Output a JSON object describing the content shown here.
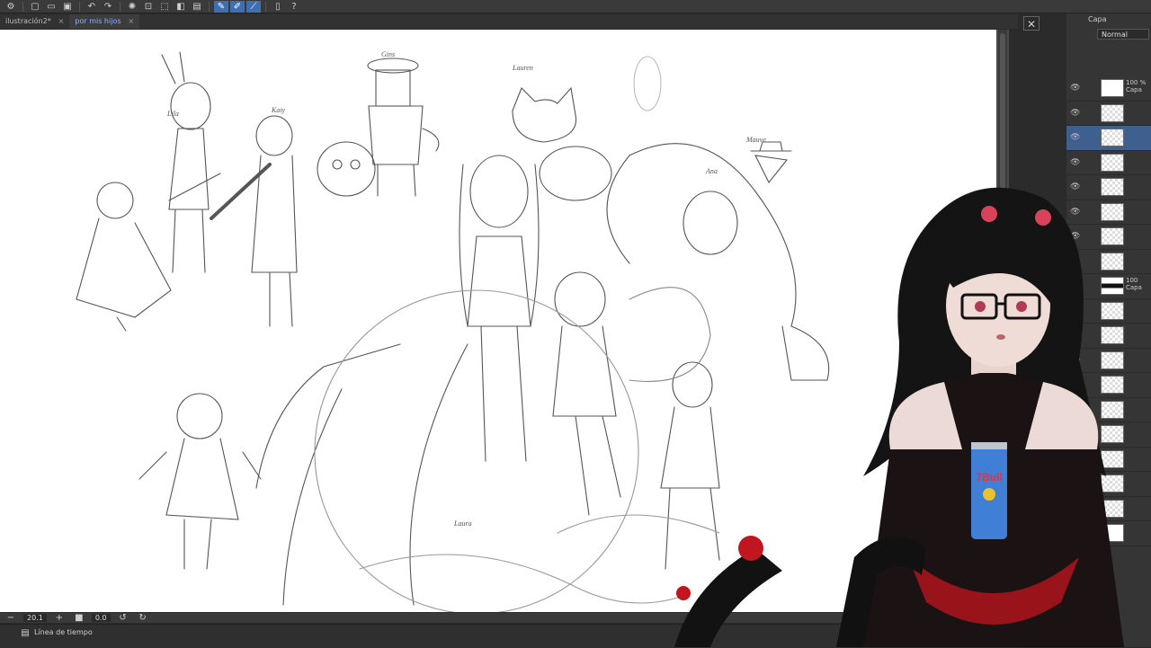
{
  "app": {
    "accent": "#3f6fb3"
  },
  "toolbar": {
    "icons": [
      "gear-icon",
      "new-file-icon",
      "open-folder-icon",
      "save-icon",
      "undo-icon",
      "redo-icon",
      "loading-icon",
      "transform-icon",
      "selection-icon",
      "brush-icon",
      "pen-icon",
      "eraser-icon",
      "ruler-icon",
      "help-icon"
    ]
  },
  "tabs": [
    {
      "label": "ilustración2*",
      "close": "×"
    },
    {
      "label": "por mis hijos",
      "close": "×"
    }
  ],
  "canvas": {
    "name_labels": [
      "Lauren",
      "Ana",
      "Kaiy",
      "Gins",
      "Lila",
      "Mauve",
      "Laura"
    ]
  },
  "status": {
    "zoom": "20.1",
    "angle": "0.0"
  },
  "timeline": {
    "label": "Línea de tiempo"
  },
  "layer_panel": {
    "header": "Capa",
    "close_glyph": "✕",
    "blend_mode": "Normal",
    "layers": [
      {
        "opacity": "100 %",
        "name": "Capa",
        "thumb": "white"
      },
      {
        "opacity": "",
        "name": "",
        "thumb": "checker"
      },
      {
        "opacity": "",
        "name": "",
        "thumb": "checker",
        "selected": true
      },
      {
        "opacity": "",
        "name": "",
        "thumb": "checker"
      },
      {
        "opacity": "",
        "name": "",
        "thumb": "checker"
      },
      {
        "opacity": "",
        "name": "",
        "thumb": "checker"
      },
      {
        "opacity": "",
        "name": "",
        "thumb": "checker"
      },
      {
        "opacity": "",
        "name": "",
        "thumb": "checker"
      },
      {
        "opacity": "100",
        "name": "Capa",
        "thumb": "dark"
      },
      {
        "opacity": "",
        "name": "",
        "thumb": "checker"
      },
      {
        "opacity": "",
        "name": "",
        "thumb": "checker"
      },
      {
        "opacity": "",
        "name": "",
        "thumb": "checker"
      },
      {
        "opacity": "",
        "name": "",
        "thumb": "checker"
      },
      {
        "opacity": "",
        "name": "",
        "thumb": "checker"
      },
      {
        "opacity": "",
        "name": "",
        "thumb": "checker"
      },
      {
        "opacity": "",
        "name": "",
        "thumb": "checker"
      },
      {
        "opacity": "",
        "name": "",
        "thumb": "checker"
      },
      {
        "opacity": "",
        "name": "",
        "thumb": "checker"
      },
      {
        "opacity": "",
        "name": "",
        "thumb": "white"
      }
    ]
  },
  "overlay": {
    "can_label": "7Bull"
  }
}
